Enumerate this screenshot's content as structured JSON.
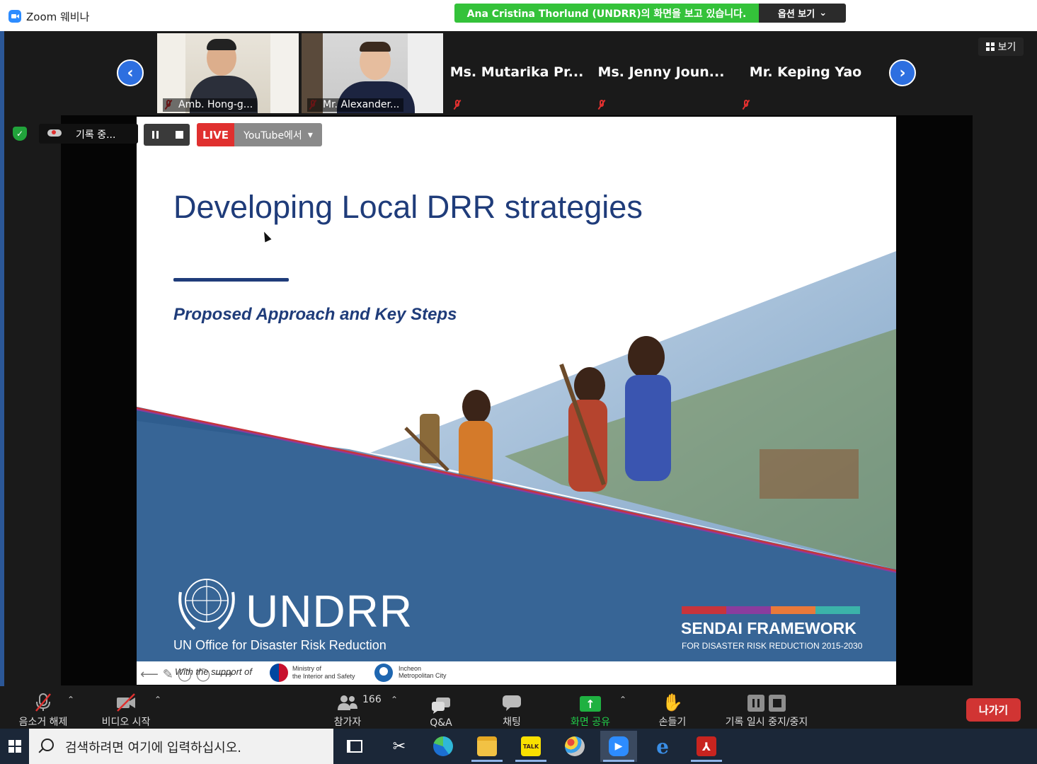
{
  "window": {
    "title": "Zoom 웨비나"
  },
  "banner": {
    "sharing_text": "Ana Cristina Thorlund (UNDRR)의 화면을 보고 있습니다.",
    "options_label": "옵션 보기"
  },
  "view_button": {
    "label": "보기"
  },
  "gallery": {
    "prev_icon": "chevron-left-icon",
    "next_icon": "chevron-right-icon",
    "participants": [
      {
        "name": "Amb. Hong-g...",
        "video": true,
        "muted": true
      },
      {
        "name": "Mr. Alexander...",
        "video": true,
        "muted": true
      },
      {
        "name": "Ms. Mutarika Pr...",
        "video": false,
        "muted": true
      },
      {
        "name": "Ms. Jenny Joun...",
        "video": false,
        "muted": true
      },
      {
        "name": "Mr. Keping Yao",
        "video": false,
        "muted": true
      }
    ]
  },
  "recording": {
    "status": "기록 중..."
  },
  "live": {
    "live_label": "LIVE",
    "destination": "YouTube에서"
  },
  "slide": {
    "title": "Developing Local DRR strategies",
    "subtitle": "Proposed Approach and Key Steps",
    "org_acronym": "UNDRR",
    "org_full": "UN Office for Disaster Risk Reduction",
    "framework_title": "SENDAI FRAMEWORK",
    "framework_sub": "FOR DISASTER RISK REDUCTION 2015-2030",
    "framework_colors": [
      "#c8343b",
      "#8a3c9e",
      "#e9793a",
      "#3bb3a9"
    ],
    "support_text": "With the support of",
    "ministry": [
      "Ministry of",
      "the Interior and Safety"
    ],
    "city": [
      "Incheon",
      "Metropolitan City"
    ]
  },
  "toolbar": {
    "unmute": "음소거 해제",
    "start_video": "비디오 시작",
    "participants": "참가자",
    "participant_count": "166",
    "qa": "Q&A",
    "chat": "채팅",
    "share_screen": "화면 공유",
    "raise_hand": "손들기",
    "recording_controls": "기록 일시 중지/중지",
    "leave": "나가기"
  },
  "taskbar": {
    "search_placeholder": "검색하려면 여기에 입력하십시오.",
    "apps": [
      "task-view-icon",
      "snipping-tool-icon",
      "edge-icon",
      "file-explorer-icon",
      "kakaotalk-icon",
      "paint-icon",
      "zoom-icon",
      "internet-explorer-icon",
      "acrobat-icon"
    ]
  }
}
